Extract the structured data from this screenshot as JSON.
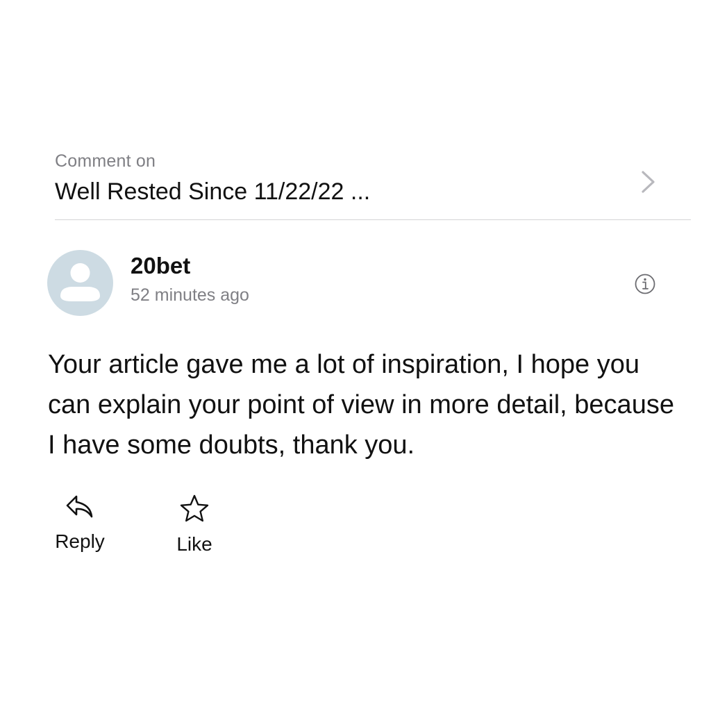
{
  "post": {
    "comment_on_label": "Comment on",
    "title": "Well Rested Since 11/22/22 ...",
    "chevron_icon": "chevron-right-icon"
  },
  "comment": {
    "author": "20bet",
    "time_ago": "52 minutes ago",
    "avatar_icon": "default-avatar-icon",
    "info_icon": "info-icon",
    "body": "Your article gave me a lot of inspiration, I hope you can explain your point of view in more detail, because I have some doubts, thank you."
  },
  "actions": {
    "reply_label": "Reply",
    "reply_icon": "reply-arrow-icon",
    "like_label": "Like",
    "like_icon": "star-outline-icon"
  },
  "colors": {
    "text": "#111111",
    "secondary_text": "#7f7f84",
    "divider": "#d3d3d6",
    "avatar_bg": "#cddbe3",
    "avatar_fg": "#ffffff"
  }
}
